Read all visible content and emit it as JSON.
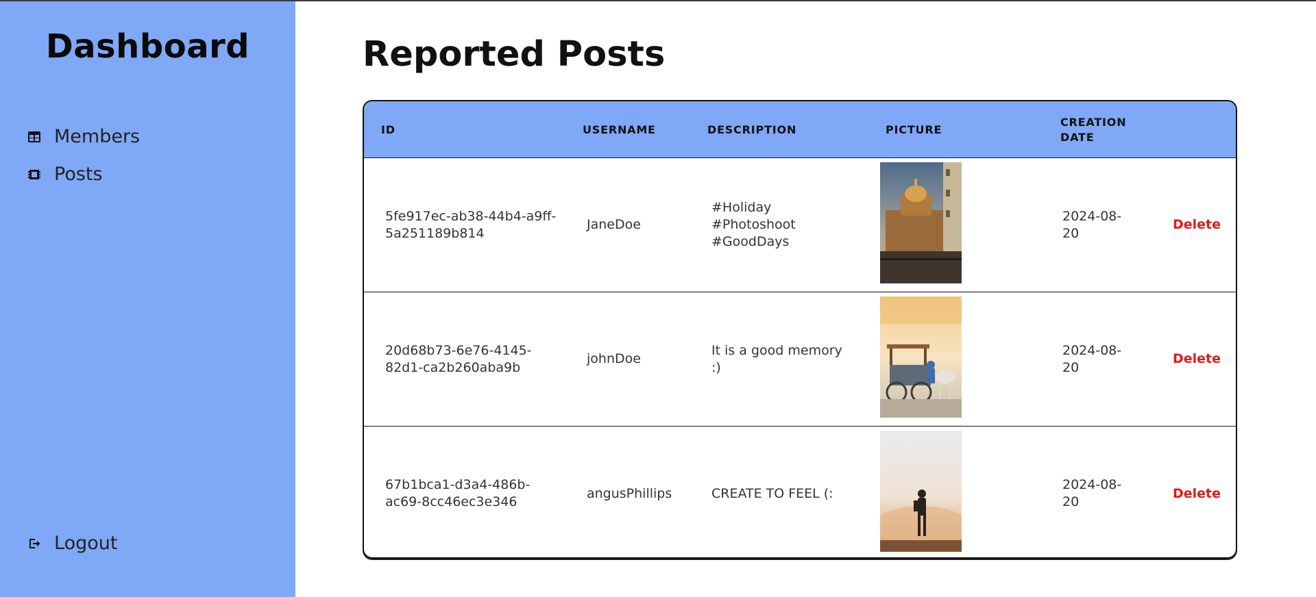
{
  "sidebar": {
    "brand": "Dashboard",
    "nav": [
      {
        "label": "Members",
        "icon": "table-icon"
      },
      {
        "label": "Posts",
        "icon": "chip-icon"
      }
    ],
    "logout": {
      "label": "Logout",
      "icon": "logout-icon"
    }
  },
  "main": {
    "title": "Reported Posts",
    "table": {
      "headers": [
        "ID",
        "USERNAME",
        "DESCRIPTION",
        "PICTURE",
        "CREATION DATE"
      ],
      "rows": [
        {
          "id": "5fe917ec-ab38-44b4-a9ff-5a251189b814",
          "username": "JaneDoe",
          "description": "#Holiday #Photoshoot #GoodDays",
          "picture": "cathedral-photo",
          "date": "2024-08-20",
          "action": "Delete"
        },
        {
          "id": "20d68b73-6e76-4145-82d1-ca2b260aba9b",
          "username": "johnDoe",
          "description": "It is a good memory :)",
          "picture": "horse-carriage-photo",
          "date": "2024-08-20",
          "action": "Delete"
        },
        {
          "id": "67b1bca1-d3a4-486b-ac69-8cc46ec3e346",
          "username": "angusPhillips",
          "description": "CREATE TO FEEL (:",
          "picture": "person-in-fog-photo",
          "date": "2024-08-20",
          "action": "Delete"
        }
      ]
    }
  },
  "colors": {
    "sidebar_bg": "#7fa8f6",
    "header_bg": "#7fa8f6",
    "delete": "#e11a1a"
  }
}
